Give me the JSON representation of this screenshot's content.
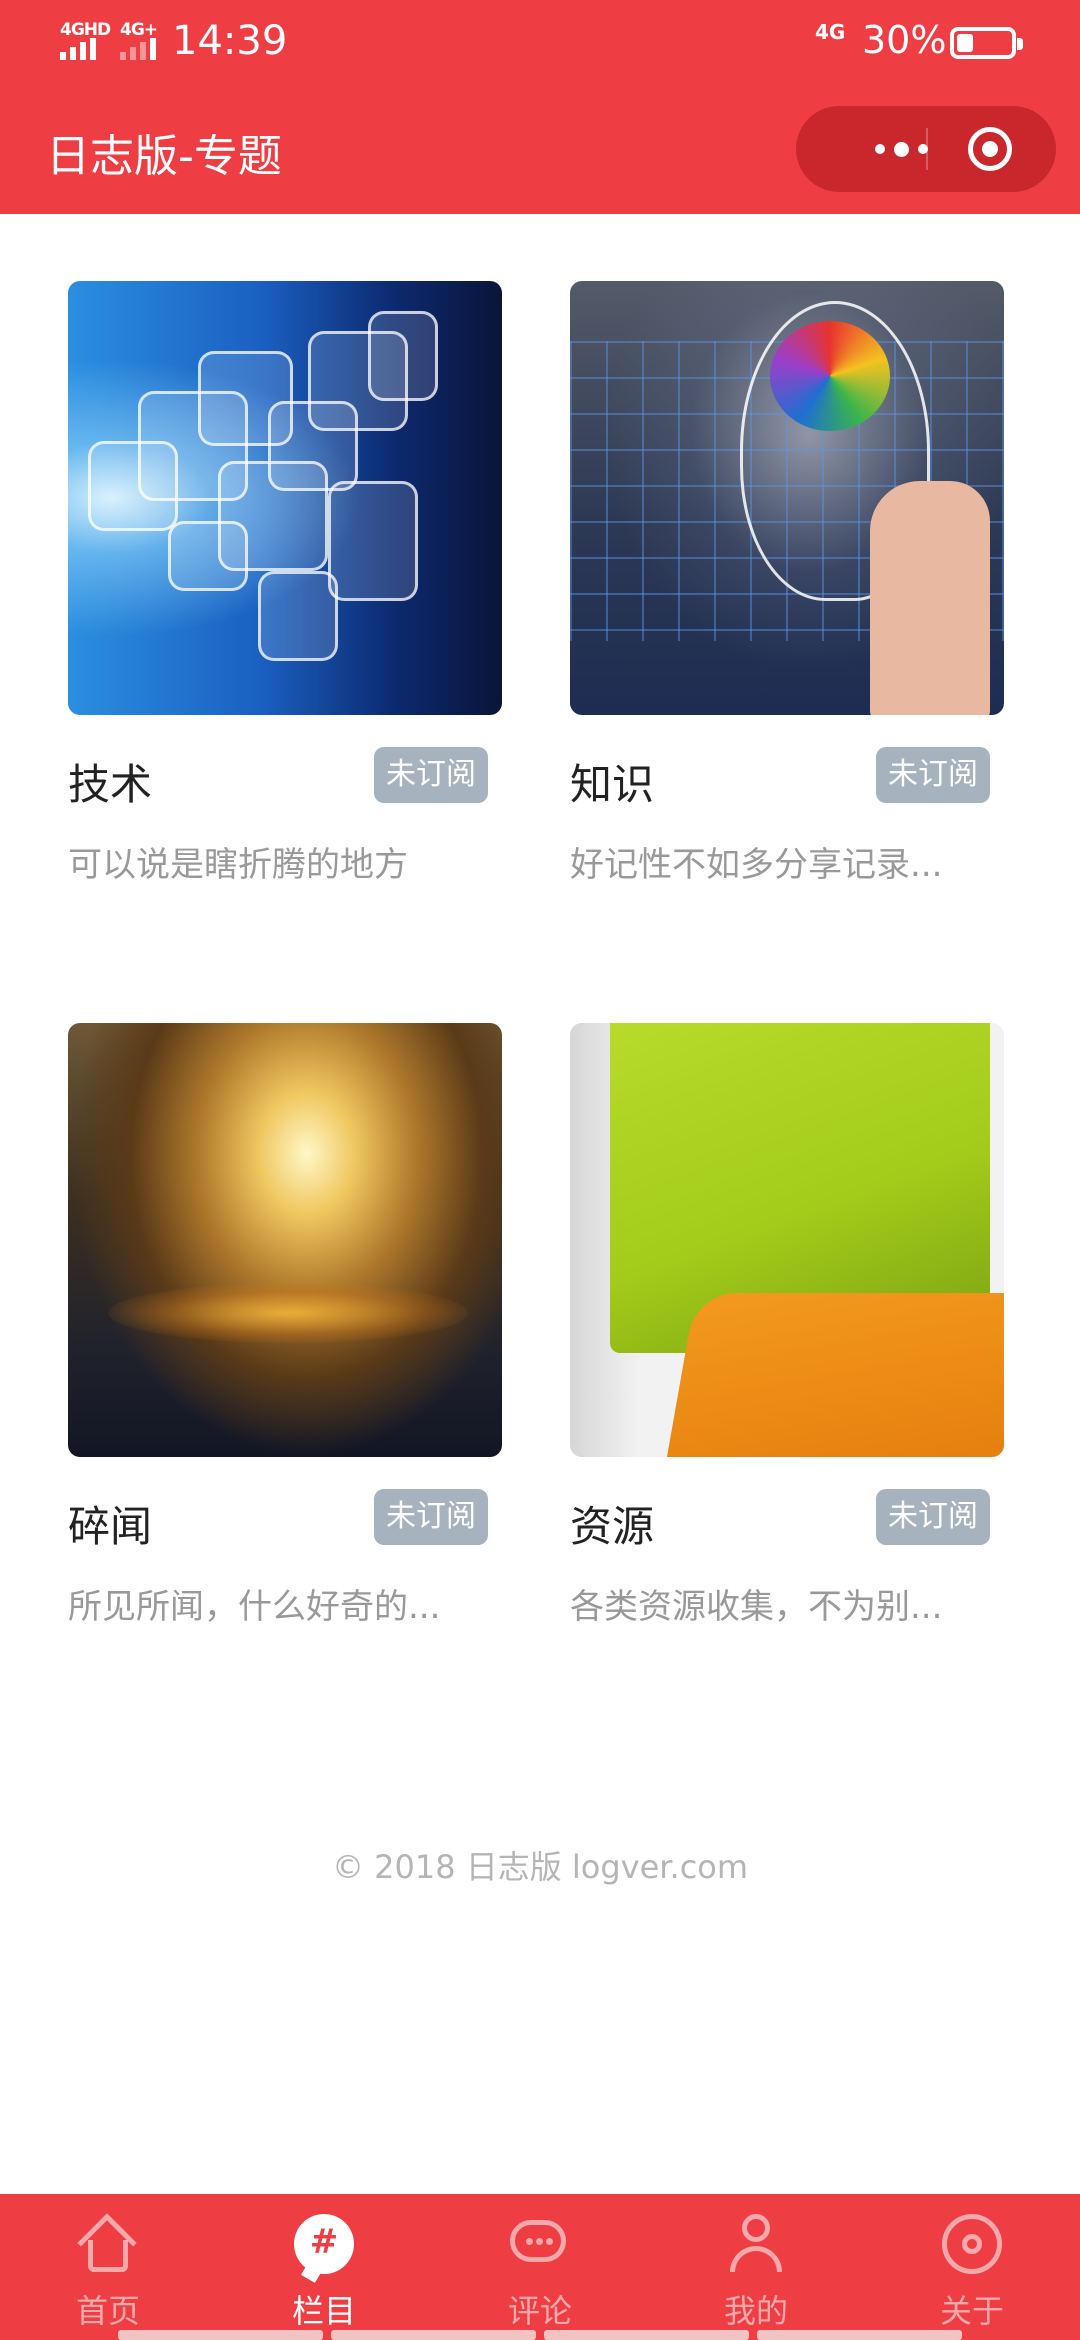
{
  "status_bar": {
    "network_left_1": "4GHD",
    "network_left_2": "4G+",
    "time": "14:39",
    "network_right": "4G",
    "battery": "30%"
  },
  "nav": {
    "title": "日志版-专题",
    "more_icon": "more-dots-icon",
    "close_icon": "target-close-icon"
  },
  "topics": [
    {
      "name": "技术",
      "badge": "未订阅",
      "desc": "可以说是瞎折腾的地方",
      "image": "tech-blue-squares"
    },
    {
      "name": "知识",
      "badge": "未订阅",
      "desc": "好记性不如多分享记录...",
      "image": "brain-head-hand"
    },
    {
      "name": "碎闻",
      "badge": "未订阅",
      "desc": "所见所闻，什么好奇的...",
      "image": "golden-clouds"
    },
    {
      "name": "资源",
      "badge": "未订阅",
      "desc": "各类资源收集，不为别...",
      "image": "green-orange-keys"
    }
  ],
  "footer": {
    "copyright": "© 2018 日志版 logver.com"
  },
  "tabbar": {
    "items": [
      {
        "label": "首页",
        "icon": "home-icon",
        "active": false
      },
      {
        "label": "栏目",
        "icon": "hash-chat-icon",
        "active": true
      },
      {
        "label": "评论",
        "icon": "chat-bubble-icon",
        "active": false
      },
      {
        "label": "我的",
        "icon": "user-icon",
        "active": false
      },
      {
        "label": "关于",
        "icon": "about-target-icon",
        "active": false
      }
    ]
  },
  "colors": {
    "brand_red": "#ee3e43",
    "badge_gray": "#a6b3be",
    "desc_gray": "#999999"
  }
}
